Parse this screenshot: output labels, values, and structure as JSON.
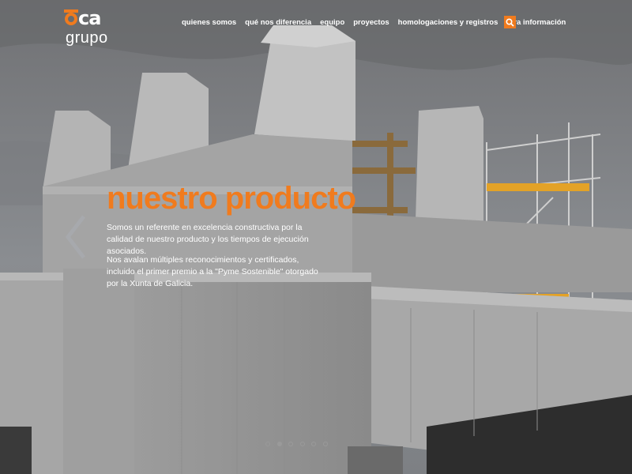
{
  "brand": {
    "mark_suffix": "ca",
    "subtitle": "grupo",
    "accent_color": "#f07b1e"
  },
  "nav": {
    "items": [
      {
        "label": "quienes somos"
      },
      {
        "label": "qué nos diferencia"
      },
      {
        "label": "equipo"
      },
      {
        "label": "proyectos"
      },
      {
        "label": "homologaciones y registros"
      },
      {
        "label": "otra información"
      }
    ],
    "search_icon": "search-icon"
  },
  "slide": {
    "title": "nuestro producto",
    "paragraph_1": "Somos un referente en excelencia constructiva por la calidad de nuestro producto y los tiempos de ejecución asociados.",
    "paragraph_2": "Nos avalan múltiples reconocimientos y certificados, incluido el primer premio a la \"Pyme Sostenible\" otorgado por la Xunta de Galicia.",
    "prev_icon": "chevron-left-icon",
    "pager_count": 6,
    "active_page": 2
  }
}
